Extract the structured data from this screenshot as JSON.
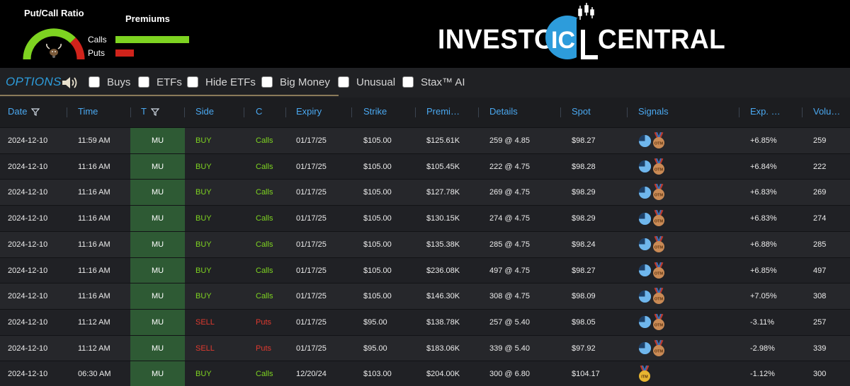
{
  "banner": {
    "put_call_title": "Put/Call Ratio",
    "premiums_title": "Premiums",
    "calls_label": "Calls",
    "puts_label": "Puts",
    "calls_fraction": 1.0,
    "puts_fraction": 0.25,
    "calls_color": "#7ed321",
    "puts_color": "#d0231b",
    "logo_left": "INVESTOR",
    "logo_mark": "IC",
    "logo_right": "CENTRAL",
    "brand_color": "#2d9cdb"
  },
  "toolbar": {
    "title": "OPTIONS",
    "filters": [
      "Buys",
      "ETFs",
      "Hide ETFs",
      "Big Money",
      "Unusual",
      "Stax™ AI"
    ]
  },
  "table": {
    "headers": {
      "date": "Date",
      "time": "Time",
      "ticker": "T",
      "side": "Side",
      "cp": "C",
      "expiry": "Expiry",
      "strike": "Strike",
      "premium": "Premi…",
      "details": "Details",
      "spot": "Spot",
      "signals": "Signals",
      "exp": "Exp. …",
      "volume": "Volu…"
    },
    "rows": [
      {
        "date": "2024-12-10",
        "time": "11:59 AM",
        "ticker": "MU",
        "side": "BUY",
        "cp": "Calls",
        "expiry": "01/17/25",
        "strike": "$105.00",
        "premium": "$125.61K",
        "details": "259 @ 4.85",
        "spot": "$98.27",
        "signals": [
          "pie-chart-icon",
          "otm-medal-icon"
        ],
        "exp": "+6.85%",
        "volume": "259"
      },
      {
        "date": "2024-12-10",
        "time": "11:16 AM",
        "ticker": "MU",
        "side": "BUY",
        "cp": "Calls",
        "expiry": "01/17/25",
        "strike": "$105.00",
        "premium": "$105.45K",
        "details": "222 @ 4.75",
        "spot": "$98.28",
        "signals": [
          "pie-chart-icon",
          "otm-medal-icon"
        ],
        "exp": "+6.84%",
        "volume": "222"
      },
      {
        "date": "2024-12-10",
        "time": "11:16 AM",
        "ticker": "MU",
        "side": "BUY",
        "cp": "Calls",
        "expiry": "01/17/25",
        "strike": "$105.00",
        "premium": "$127.78K",
        "details": "269 @ 4.75",
        "spot": "$98.29",
        "signals": [
          "pie-chart-icon",
          "otm-medal-icon"
        ],
        "exp": "+6.83%",
        "volume": "269"
      },
      {
        "date": "2024-12-10",
        "time": "11:16 AM",
        "ticker": "MU",
        "side": "BUY",
        "cp": "Calls",
        "expiry": "01/17/25",
        "strike": "$105.00",
        "premium": "$130.15K",
        "details": "274 @ 4.75",
        "spot": "$98.29",
        "signals": [
          "pie-chart-icon",
          "otm-medal-icon"
        ],
        "exp": "+6.83%",
        "volume": "274"
      },
      {
        "date": "2024-12-10",
        "time": "11:16 AM",
        "ticker": "MU",
        "side": "BUY",
        "cp": "Calls",
        "expiry": "01/17/25",
        "strike": "$105.00",
        "premium": "$135.38K",
        "details": "285 @ 4.75",
        "spot": "$98.24",
        "signals": [
          "pie-chart-icon",
          "otm-medal-icon"
        ],
        "exp": "+6.88%",
        "volume": "285"
      },
      {
        "date": "2024-12-10",
        "time": "11:16 AM",
        "ticker": "MU",
        "side": "BUY",
        "cp": "Calls",
        "expiry": "01/17/25",
        "strike": "$105.00",
        "premium": "$236.08K",
        "details": "497 @ 4.75",
        "spot": "$98.27",
        "signals": [
          "pie-chart-icon",
          "otm-medal-icon"
        ],
        "exp": "+6.85%",
        "volume": "497"
      },
      {
        "date": "2024-12-10",
        "time": "11:16 AM",
        "ticker": "MU",
        "side": "BUY",
        "cp": "Calls",
        "expiry": "01/17/25",
        "strike": "$105.00",
        "premium": "$146.30K",
        "details": "308 @ 4.75",
        "spot": "$98.09",
        "signals": [
          "pie-chart-icon",
          "otm-medal-icon"
        ],
        "exp": "+7.05%",
        "volume": "308"
      },
      {
        "date": "2024-12-10",
        "time": "11:12 AM",
        "ticker": "MU",
        "side": "SELL",
        "cp": "Puts",
        "expiry": "01/17/25",
        "strike": "$95.00",
        "premium": "$138.78K",
        "details": "257 @ 5.40",
        "spot": "$98.05",
        "signals": [
          "pie-chart-icon",
          "otm-medal-icon"
        ],
        "exp": "-3.11%",
        "volume": "257"
      },
      {
        "date": "2024-12-10",
        "time": "11:12 AM",
        "ticker": "MU",
        "side": "SELL",
        "cp": "Puts",
        "expiry": "01/17/25",
        "strike": "$95.00",
        "premium": "$183.06K",
        "details": "339 @ 5.40",
        "spot": "$97.92",
        "signals": [
          "pie-chart-icon",
          "otm-medal-icon"
        ],
        "exp": "-2.98%",
        "volume": "339"
      },
      {
        "date": "2024-12-10",
        "time": "06:30 AM",
        "ticker": "MU",
        "side": "BUY",
        "cp": "Calls",
        "expiry": "12/20/24",
        "strike": "$103.00",
        "premium": "$204.00K",
        "details": "300 @ 6.80",
        "spot": "$104.17",
        "signals": [
          "itm-medal-icon"
        ],
        "exp": "-1.12%",
        "volume": "300"
      }
    ]
  }
}
